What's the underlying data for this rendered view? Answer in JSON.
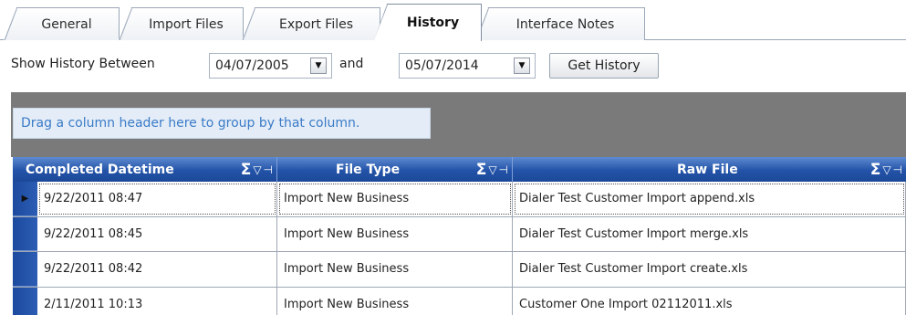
{
  "tabs": [
    {
      "label": "General",
      "active": false
    },
    {
      "label": "Import Files",
      "active": false
    },
    {
      "label": "Export Files",
      "active": false
    },
    {
      "label": "History",
      "active": true
    },
    {
      "label": "Interface Notes",
      "active": false
    }
  ],
  "toolbar": {
    "show_history_label": "Show History Between",
    "start_date": "04/07/2005",
    "and_label": "and",
    "end_date": "05/07/2014",
    "get_history_label": "Get History"
  },
  "grid": {
    "group_hint": "Drag a column header here to group by that column.",
    "columns": [
      "Completed Datetime",
      "File Type",
      "Raw File"
    ],
    "rows": [
      {
        "completed": "9/22/2011 08:47",
        "file_type": "Import New Business",
        "raw_file": "Dialer Test Customer Import append.xls",
        "selected": true
      },
      {
        "completed": "9/22/2011 08:45",
        "file_type": "Import New Business",
        "raw_file": "Dialer Test Customer Import merge.xls",
        "selected": false
      },
      {
        "completed": "9/22/2011 08:42",
        "file_type": "Import New Business",
        "raw_file": "Dialer Test Customer Import create.xls",
        "selected": false
      },
      {
        "completed": "2/11/2011 10:13",
        "file_type": "Import New Business",
        "raw_file": "Customer One Import 02112011.xls",
        "selected": false
      }
    ]
  },
  "icons": {
    "dropdown": "chevron-down-icon",
    "sigma": "sum-icon",
    "filter": "filter-icon",
    "pin": "pin-icon",
    "row_pointer": "row-pointer-icon"
  },
  "colors": {
    "header_blue": "#2353a8",
    "group_panel": "#7a7a7a",
    "hint_text": "#3b7bc7"
  }
}
